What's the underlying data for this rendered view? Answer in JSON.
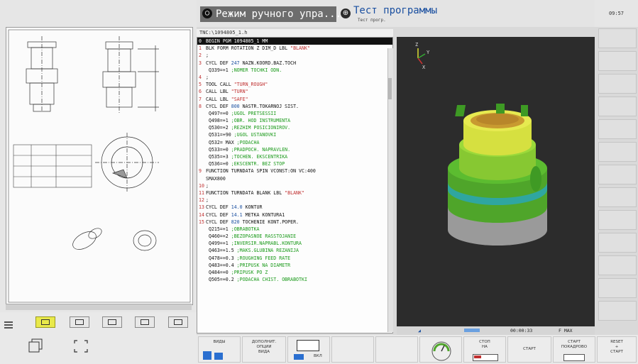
{
  "header": {
    "mode_main": "Режим ручного упра...",
    "mode_prog_title": "Тест программы",
    "mode_prog_sub": "Тест прогр.",
    "clock": "09:57"
  },
  "code": {
    "path": "TNC:\\1094805_1.h",
    "lines": [
      {
        "n": "0",
        "t": "BEGIN PGM 1094805_1 MM",
        "sel": true
      },
      {
        "n": "1",
        "t": "BLK FORM ROTATION Z DIM_D LBL ",
        "s": "\"BLANK\""
      },
      {
        "n": "2",
        "t": ";"
      },
      {
        "n": "3",
        "t": "CYCL DEF ",
        "k": "247",
        "t2": " NAZN.KOORD.BAZ.TOCH"
      },
      {
        "n": "",
        "t": "   Q339=+1     ",
        "c": ";NOMER TOCHKI ODN."
      },
      {
        "n": "4",
        "t": ";"
      },
      {
        "n": "5",
        "t": "TOOL CALL ",
        "s": "\"TURN_ROUGH\""
      },
      {
        "n": "6",
        "t": "CALL LBL ",
        "s": "\"TURN\""
      },
      {
        "n": "7",
        "t": "CALL LBL ",
        "s": "\"SAFE\""
      },
      {
        "n": "8",
        "t": "CYCL DEF ",
        "k": "800",
        "t2": " NASTR.TOKARNOJ SIST."
      },
      {
        "n": "",
        "t": "   Q497=+0     ",
        "c": ";UGOL PRETSESSII"
      },
      {
        "n": "",
        "t": "   Q498=+1     ",
        "c": ";OBR. HOD INSTRUMENTA"
      },
      {
        "n": "",
        "t": "   Q530=+2     ",
        "c": ";REZHIM POSICIONIROV."
      },
      {
        "n": "",
        "t": "   Q531=+90    ",
        "c": ";UGOL USTANOVKI"
      },
      {
        "n": "",
        "t": "   Q532= MAX   ",
        "c": ";PODACHA"
      },
      {
        "n": "",
        "t": "   Q533=+0     ",
        "c": ";PRADPOCH. NAPRAVLEN."
      },
      {
        "n": "",
        "t": "   Q535=+3     ",
        "c": ";TOCHEN. EKSCENTRIKA"
      },
      {
        "n": "",
        "t": "   Q536=+0     ",
        "c": ";EKSCENTR. BEZ STOP"
      },
      {
        "n": "9",
        "t": "FUNCTION TURNDATA SPIN VCONST:ON VC:400"
      },
      {
        "n": "",
        "t": "SMAX800"
      },
      {
        "n": "10",
        "t": ";"
      },
      {
        "n": "11",
        "t": "FUNCTION TURNDATA BLANK LBL ",
        "s": "\"BLANK\""
      },
      {
        "n": "12",
        "t": ";"
      },
      {
        "n": "13",
        "t": "CYCL DEF ",
        "k": "14.0",
        "t2": " KONTUR"
      },
      {
        "n": "14",
        "t": "CYCL DEF ",
        "k": "14.1",
        "t2": " METKA KONTURA1"
      },
      {
        "n": "15",
        "t": "CYCL DEF ",
        "k": "820",
        "t2": " TOCHENIE KONT.POPER."
      },
      {
        "n": "",
        "t": "   Q215=+1     ",
        "c": ";OBRABOTKA"
      },
      {
        "n": "",
        "t": "   Q460=+2     ",
        "c": ";BEZOPASNOE RASSTOJANIE"
      },
      {
        "n": "",
        "t": "   Q499=+1     ",
        "c": ";INVERSIR.NAPRABL.KONTURA"
      },
      {
        "n": "",
        "t": "   Q463=+1.5   ",
        "c": ";MAKS.GLUBINA REZANIJA"
      },
      {
        "n": "",
        "t": "   Q478=+0.3   ",
        "c": ";ROUGHING FEED RATE"
      },
      {
        "n": "",
        "t": "   Q483=+0.4   ",
        "c": ";PRIPUSK NA DIAMETR"
      },
      {
        "n": "",
        "t": "   Q484=+0     ",
        "c": ";PRIPUSK PO Z"
      },
      {
        "n": "",
        "t": "   Q505=+0.2   ",
        "c": ";PODACHA CHIST. OBRABOTKI"
      }
    ]
  },
  "view": {
    "time": "00:00:33",
    "feed": "F MAX"
  },
  "softkeys": {
    "views": "ВИДЫ",
    "extra_1": "ДОПОЛНИТ.",
    "extra_2": "ОПЦИИ",
    "extra_3": "ВИДА",
    "on": "ВКЛ",
    "stop_1": "СТОП",
    "stop_2": "НА",
    "start": "СТАРТ",
    "start_step_1": "СТАРТ",
    "start_step_2": "ПОКАДРОВО",
    "reset_1": "RESET",
    "reset_2": "+",
    "reset_3": "СТАРТ"
  },
  "colors": {
    "accent_green": "#6fc52e",
    "part_gold": "#c8a030",
    "part_cyan": "#3ab0a0",
    "viewport_bg": "#2c2c2c"
  }
}
